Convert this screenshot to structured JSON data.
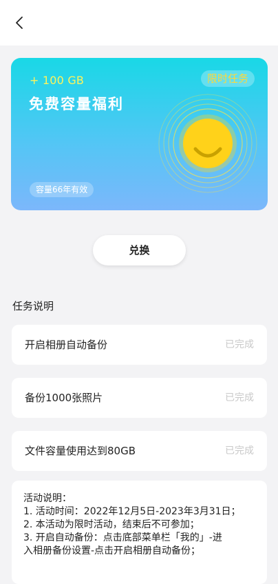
{
  "card": {
    "subtitle": "+ 100 GB",
    "title": "免费容量福利",
    "tag": "限时任务",
    "validity": "容量66年有效"
  },
  "redeem_label": "兑换",
  "tasks_section": {
    "title": "任务说明",
    "items": [
      {
        "name": "开启相册自动备份",
        "status": "已完成"
      },
      {
        "name": "备份1000张照片",
        "status": "已完成"
      },
      {
        "name": "文件容量使用达到80GB",
        "status": "已完成"
      }
    ]
  },
  "description": {
    "lines": [
      "活动说明：",
      "1. 活动时间：2022年12月5日-2023年3月31日；",
      "2. 本活动为限时活动，结束后不可参加；",
      "3. 开启自动备份：点击底部菜单栏「我的」-进",
      "入相册备份设置-点击开启相册自动备份；"
    ]
  },
  "icons": {
    "back": "chevron-left-icon",
    "mascot": "smiley-face-icon"
  },
  "colors": {
    "card_gradient_top": "#19d8e6",
    "card_gradient_bottom": "#7cb7fb",
    "accent_yellow": "#ffd83a",
    "status_gray": "#c9c9c9"
  }
}
